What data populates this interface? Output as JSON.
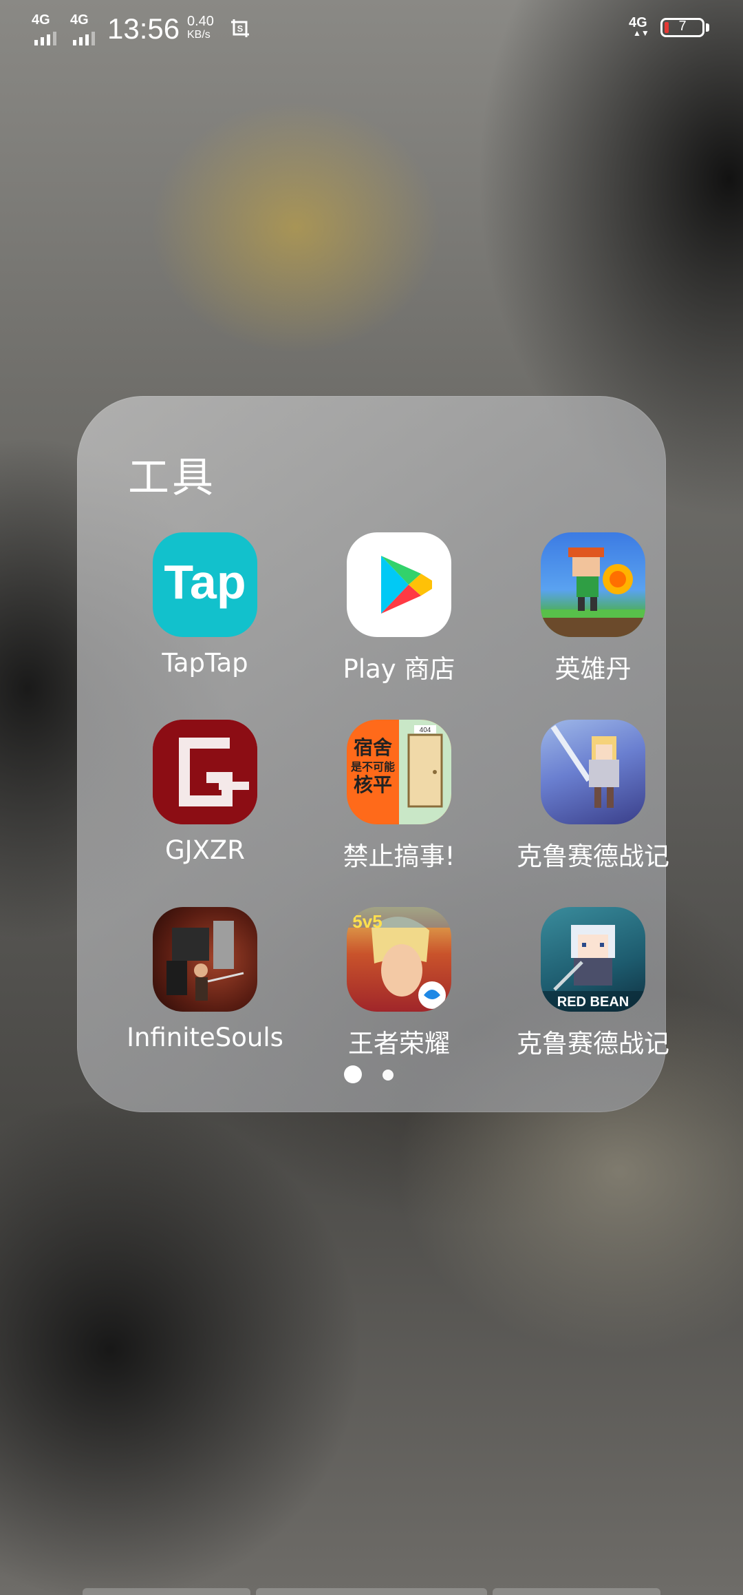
{
  "status_bar": {
    "sim1_network": "4G",
    "sim2_network": "4G",
    "time": "13:56",
    "net_speed_value": "0.40",
    "net_speed_unit": "KB/s",
    "right_network": "4G",
    "battery_level": "7",
    "battery_color": "#e53935"
  },
  "folder": {
    "title": "工具",
    "apps": [
      {
        "label": "TapTap",
        "icon": "taptap-icon"
      },
      {
        "label": "Play 商店",
        "icon": "play-store-icon"
      },
      {
        "label": "英雄丹",
        "icon": "hero-dan-icon"
      },
      {
        "label": "GJXZR",
        "icon": "gjxzr-icon"
      },
      {
        "label": "禁止搞事!",
        "icon": "no-trouble-icon"
      },
      {
        "label": "克鲁赛德战记",
        "icon": "crusaders-quest-icon"
      },
      {
        "label": "InfiniteSouls",
        "icon": "infinite-souls-icon"
      },
      {
        "label": "王者荣耀",
        "icon": "honor-of-kings-icon"
      },
      {
        "label": "克鲁赛德战记",
        "icon": "crusaders-quest-red-bean-icon"
      }
    ],
    "page_indicator": {
      "current": 1,
      "total": 2
    }
  },
  "icon_text": {
    "taptap": "Tap",
    "no_trouble_line1": "宿舍",
    "no_trouble_line2": "是不可能",
    "no_trouble_line3": "核平",
    "no_trouble_door": "404",
    "honor_badge": "5v5",
    "red_bean": "RED BEAN"
  }
}
